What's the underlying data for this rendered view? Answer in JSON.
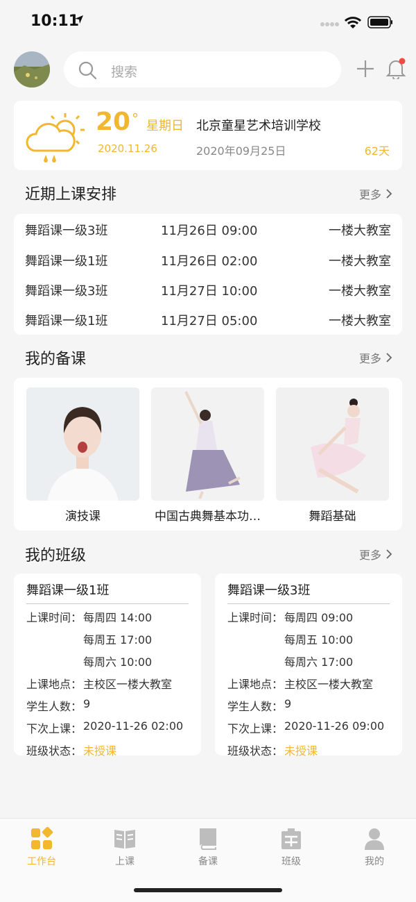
{
  "status": {
    "time": "10:11"
  },
  "search": {
    "placeholder": "搜索"
  },
  "weather": {
    "temperature": "20",
    "degree": "°",
    "weekday": "星期日",
    "date": "2020.11.26",
    "school_name": "北京童星艺术培训学校",
    "school_date": "2020年09月25日",
    "days": "62天"
  },
  "schedule": {
    "title": "近期上课安排",
    "more": "更多",
    "rows": [
      {
        "class": "舞蹈课一级3班",
        "time": "11月26日 09:00",
        "room": "一楼大教室"
      },
      {
        "class": "舞蹈课一级1班",
        "time": "11月26日 02:00",
        "room": "一楼大教室"
      },
      {
        "class": "舞蹈课一级3班",
        "time": "11月27日 10:00",
        "room": "一楼大教室"
      },
      {
        "class": "舞蹈课一级1班",
        "time": "11月27日 05:00",
        "room": "一楼大教室"
      }
    ]
  },
  "prep": {
    "title": "我的备课",
    "more": "更多",
    "items": [
      {
        "label": "演技课"
      },
      {
        "label": "中国古典舞基本功…"
      },
      {
        "label": "舞蹈基础"
      }
    ]
  },
  "classes": {
    "title": "我的班级",
    "more": "更多",
    "labels": {
      "time": "上课时间：",
      "place": "上课地点：",
      "students": "学生人数：",
      "next": "下次上课：",
      "status": "班级状态："
    },
    "items": [
      {
        "name": "舞蹈课一级1班",
        "times": [
          "每周四 14:00",
          "每周五 17:00",
          "每周六 10:00"
        ],
        "place": "主校区一楼大教室",
        "students": "9",
        "next": "2020-11-26 02:00",
        "status": "未授课"
      },
      {
        "name": "舞蹈课一级3班",
        "times": [
          "每周四 09:00",
          "每周五 10:00",
          "每周六 17:00"
        ],
        "place": "主校区一楼大教室",
        "students": "9",
        "next": "2020-11-26 09:00",
        "status": "未授课"
      }
    ]
  },
  "tabs": [
    {
      "label": "工作台",
      "icon": "workbench-icon"
    },
    {
      "label": "上课",
      "icon": "book-open-icon"
    },
    {
      "label": "备课",
      "icon": "book-icon"
    },
    {
      "label": "班级",
      "icon": "classroom-icon"
    },
    {
      "label": "我的",
      "icon": "user-icon"
    }
  ],
  "colors": {
    "accent": "#f0b72f",
    "notification": "#f04a43"
  }
}
